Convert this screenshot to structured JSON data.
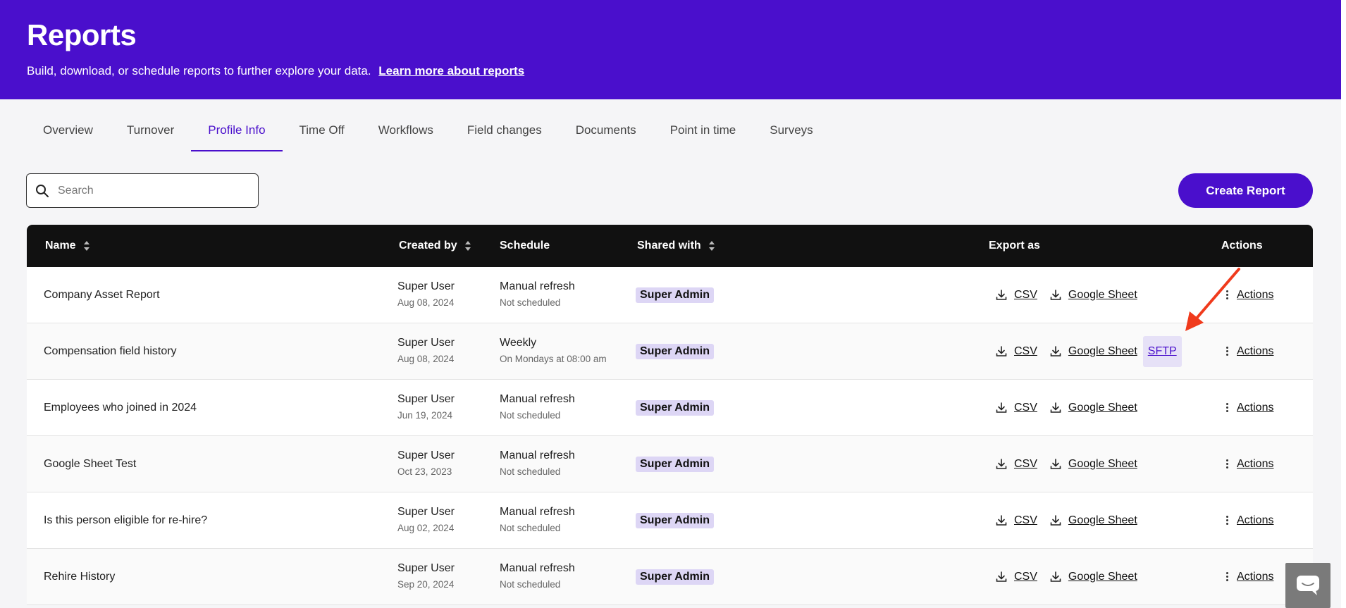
{
  "header": {
    "title": "Reports",
    "subtitle": "Build, download, or schedule reports to further explore your data.",
    "learn_more": "Learn more about reports"
  },
  "tabs": [
    {
      "label": "Overview"
    },
    {
      "label": "Turnover"
    },
    {
      "label": "Profile Info",
      "active": true
    },
    {
      "label": "Time Off"
    },
    {
      "label": "Workflows"
    },
    {
      "label": "Field changes"
    },
    {
      "label": "Documents"
    },
    {
      "label": "Point in time"
    },
    {
      "label": "Surveys"
    }
  ],
  "search": {
    "placeholder": "Search",
    "value": ""
  },
  "create_button": "Create Report",
  "table": {
    "columns": {
      "name": "Name",
      "created_by": "Created by",
      "schedule": "Schedule",
      "shared_with": "Shared with",
      "export_as": "Export as",
      "actions": "Actions"
    },
    "rows": [
      {
        "name": "Company Asset Report",
        "created_by": "Super User",
        "created_date": "Aug 08, 2024",
        "schedule": "Manual refresh",
        "schedule_detail": "Not scheduled",
        "shared_with": "Super Admin",
        "csv": "CSV",
        "gsheet": "Google Sheet",
        "actions": "Actions"
      },
      {
        "name": "Compensation field history",
        "created_by": "Super User",
        "created_date": "Aug 08, 2024",
        "schedule": "Weekly",
        "schedule_detail": "On Mondays at 08:00 am",
        "shared_with": "Super Admin",
        "csv": "CSV",
        "gsheet": "Google Sheet",
        "sftp": "SFTP",
        "actions": "Actions"
      },
      {
        "name": "Employees who joined in 2024",
        "created_by": "Super User",
        "created_date": "Jun 19, 2024",
        "schedule": "Manual refresh",
        "schedule_detail": "Not scheduled",
        "shared_with": "Super Admin",
        "csv": "CSV",
        "gsheet": "Google Sheet",
        "actions": "Actions"
      },
      {
        "name": "Google Sheet Test",
        "created_by": "Super User",
        "created_date": "Oct 23, 2023",
        "schedule": "Manual refresh",
        "schedule_detail": "Not scheduled",
        "shared_with": "Super Admin",
        "csv": "CSV",
        "gsheet": "Google Sheet",
        "actions": "Actions"
      },
      {
        "name": "Is this person eligible for re-hire?",
        "created_by": "Super User",
        "created_date": "Aug 02, 2024",
        "schedule": "Manual refresh",
        "schedule_detail": "Not scheduled",
        "shared_with": "Super Admin",
        "csv": "CSV",
        "gsheet": "Google Sheet",
        "actions": "Actions"
      },
      {
        "name": "Rehire History",
        "created_by": "Super User",
        "created_date": "Sep 20, 2024",
        "schedule": "Manual refresh",
        "schedule_detail": "Not scheduled",
        "shared_with": "Super Admin",
        "csv": "CSV",
        "gsheet": "Google Sheet",
        "actions": "Actions"
      }
    ]
  },
  "colors": {
    "brand": "#4a0fcc",
    "header_row": "#111111",
    "badge": "#ddd6f5",
    "annotation_arrow": "#f03a1c"
  },
  "icons": {
    "search": "search-icon",
    "download": "download-icon",
    "more": "kebab-icon",
    "chat": "chat-icon",
    "annotation": "arrow-annotation"
  }
}
